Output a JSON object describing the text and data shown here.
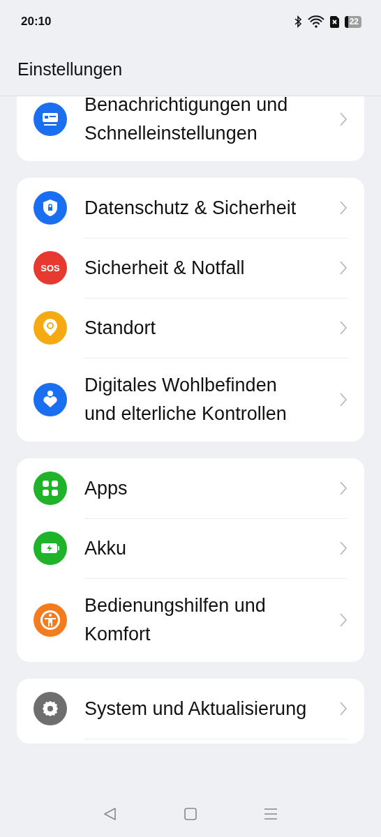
{
  "status_bar": {
    "time": "20:10",
    "battery": "22"
  },
  "header": {
    "title": "Einstellungen"
  },
  "groups": [
    {
      "items": [
        {
          "label": "Benachrichtigungen und Schnelleinstellungen",
          "kind": "notifications",
          "color": "#1a6ef0"
        }
      ]
    },
    {
      "items": [
        {
          "label": "Datenschutz & Sicherheit",
          "kind": "privacy",
          "color": "#1a6ef0"
        },
        {
          "label": "Sicherheit & Notfall",
          "kind": "sos",
          "color": "#e6392f",
          "icon_text": "SOS"
        },
        {
          "label": "Standort",
          "kind": "location",
          "color": "#f5aa12"
        },
        {
          "label": "Digitales Wohlbefinden und elterliche Kontrollen",
          "kind": "wellbeing",
          "color": "#1a6ef0"
        }
      ]
    },
    {
      "items": [
        {
          "label": "Apps",
          "kind": "apps",
          "color": "#1fb32a"
        },
        {
          "label": "Akku",
          "kind": "battery",
          "color": "#1fb32a"
        },
        {
          "label": "Bedienungshilfen und Komfort",
          "kind": "accessibility",
          "color": "#f57c1e"
        }
      ]
    },
    {
      "items": [
        {
          "label": "System und Aktualisierung",
          "kind": "system",
          "color": "#6e6e6e"
        }
      ]
    }
  ]
}
